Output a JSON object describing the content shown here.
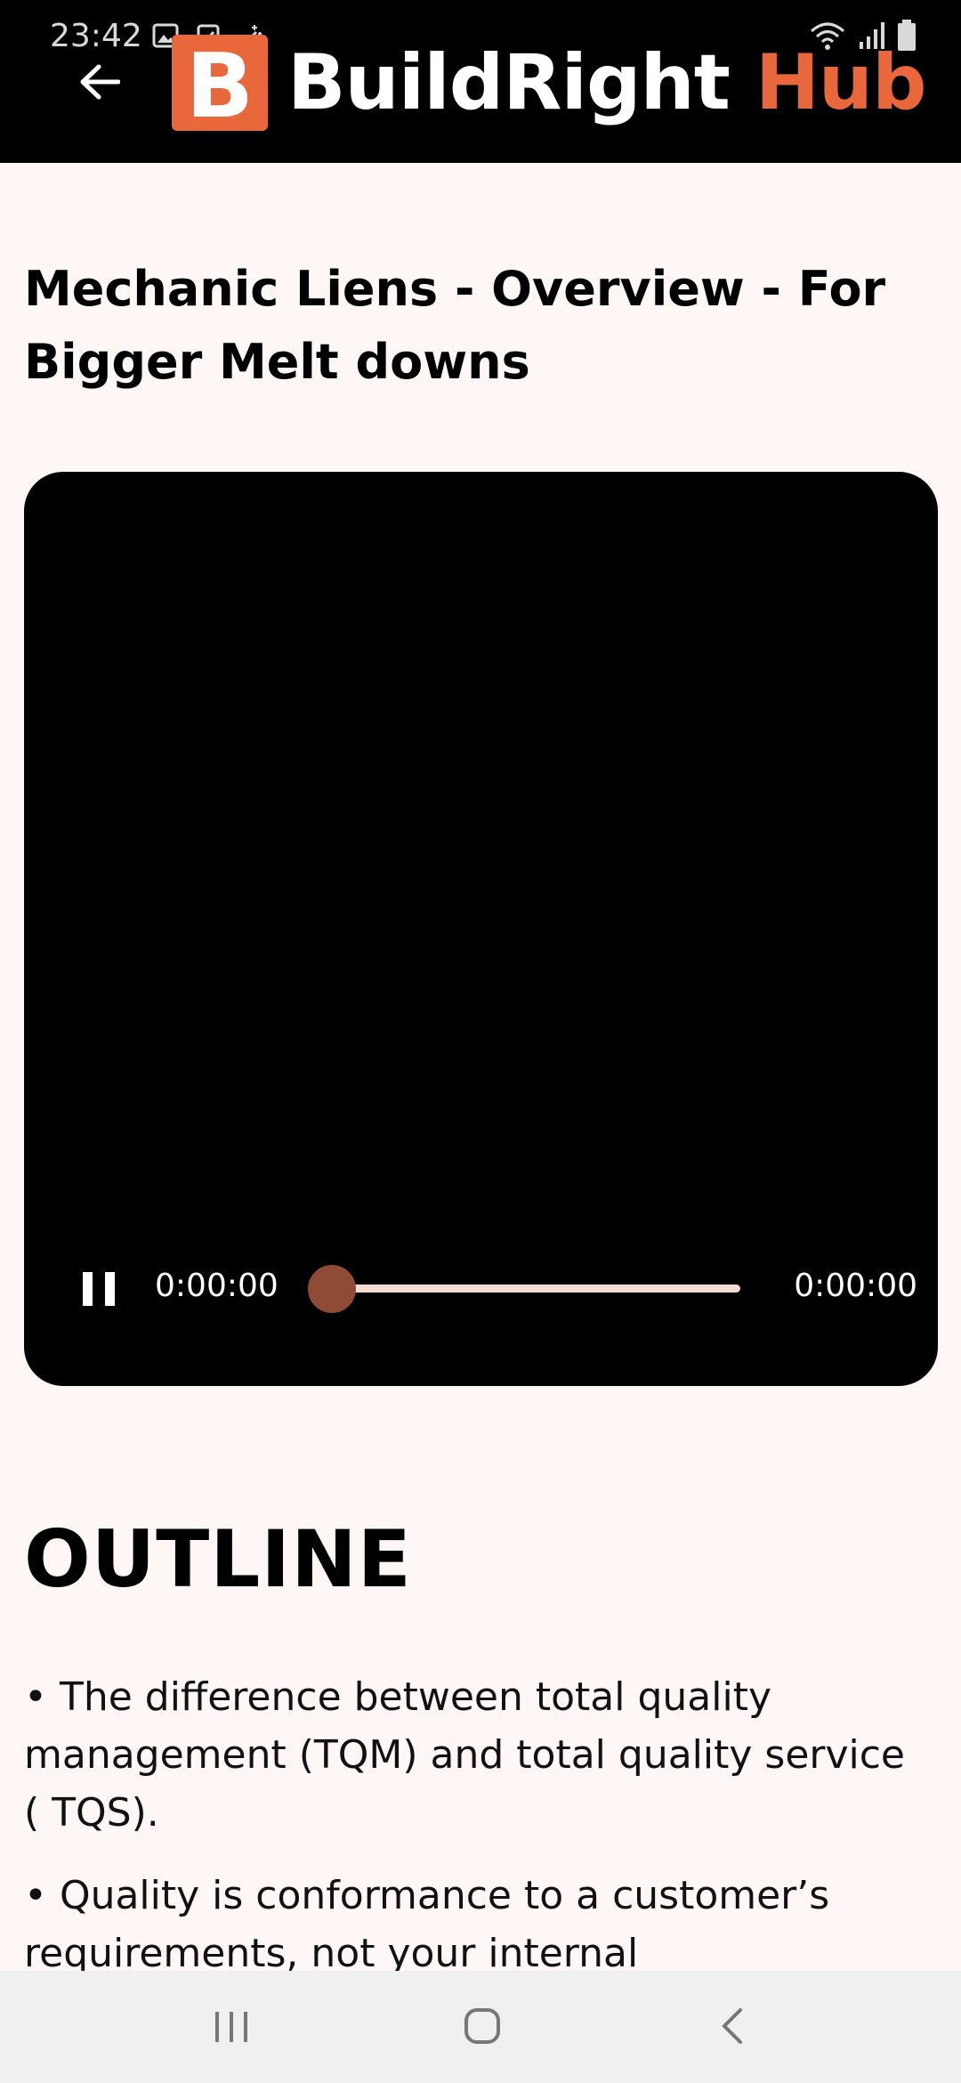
{
  "status_bar": {
    "time": "23:42",
    "icons": [
      "image-notification-icon",
      "clipboard-notification-icon",
      "sparkle-notification-icon",
      "wifi-icon",
      "signal-icon",
      "battery-icon"
    ]
  },
  "app_bar": {
    "back_icon": "arrow-left-icon",
    "logo_letter": "B",
    "logo_text_main": "BuildRight ",
    "logo_text_accent": "Hub",
    "colors": {
      "background": "#000000",
      "accent": "#e8673b"
    }
  },
  "content": {
    "title": "Mechanic Liens - Overview - For Bigger Melt downs",
    "video": {
      "current_time": "0:00:00",
      "total_time": "0:00:00",
      "progress": 0,
      "state": "playing",
      "thumb_color": "#8e4b36",
      "track_color": "#f4dcd3"
    },
    "outline_heading": "OUTLINE",
    "outline_items": [
      "• The difference between total quality management (TQM) and total quality service ( TQS).",
      "• Quality is conformance to a customer’s requirements, not your internal"
    ]
  },
  "system_nav": {
    "recents_icon": "recents-icon",
    "home_icon": "home-icon",
    "back_icon": "back-chevron-icon"
  }
}
